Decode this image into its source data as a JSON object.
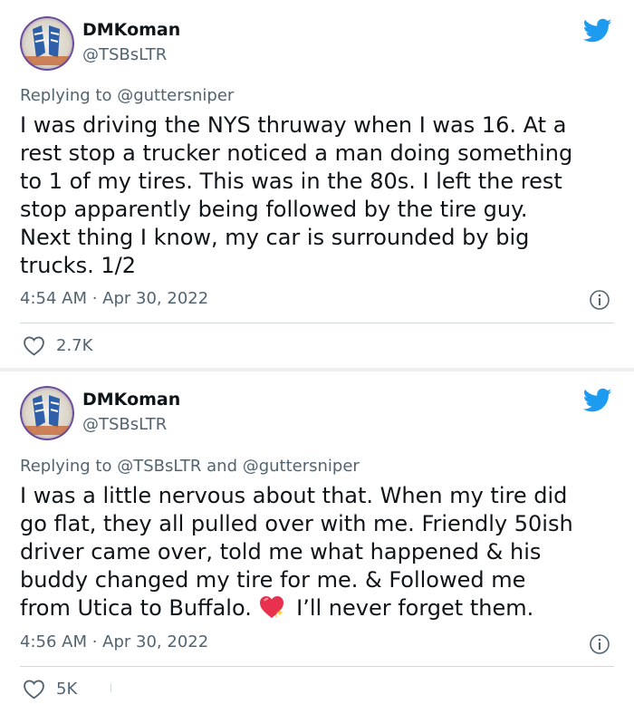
{
  "tweets": [
    {
      "author": {
        "name": "DMKoman",
        "handle": "@TSBsLTR"
      },
      "replying_to": {
        "prefix": "Replying to ",
        "mentions": "@guttersniper"
      },
      "text": "I was driving the NYS thruway when I was 16. At a\nrest stop a trucker noticed a man doing something\nto 1 of my tires. This was in the 80s. I left the rest\nstop apparently being followed by the tire guy.\nNext thing I know, my car is surrounded by big\ntrucks. 1/2",
      "timestamp": "4:54 AM · Apr 30, 2022",
      "likes": "2.7K"
    },
    {
      "author": {
        "name": "DMKoman",
        "handle": "@TSBsLTR"
      },
      "replying_to": {
        "prefix": "Replying to ",
        "mentions": "@TSBsLTR and @guttersniper"
      },
      "text_before_emoji": "I was a little nervous about that. When my tire did\ngo flat, they all pulled over with me. Friendly 50ish\ndriver came over, told me what happened & his\nbuddy changed my tire for me. & Followed me\nfrom Utica to Buffalo. ",
      "emoji": "sparkling-heart-emoji",
      "text_after_emoji": " I’ll never forget them.",
      "timestamp": "4:56 AM · Apr 30, 2022",
      "likes": "5K"
    }
  ],
  "colors": {
    "twitter_blue": "#1d9bf0",
    "secondary_text": "#536471",
    "primary_text": "#0f1419",
    "divider": "#cfd9de"
  },
  "icons": {
    "brand": "twitter-bird-icon",
    "info": "info-icon",
    "like": "heart-icon"
  }
}
